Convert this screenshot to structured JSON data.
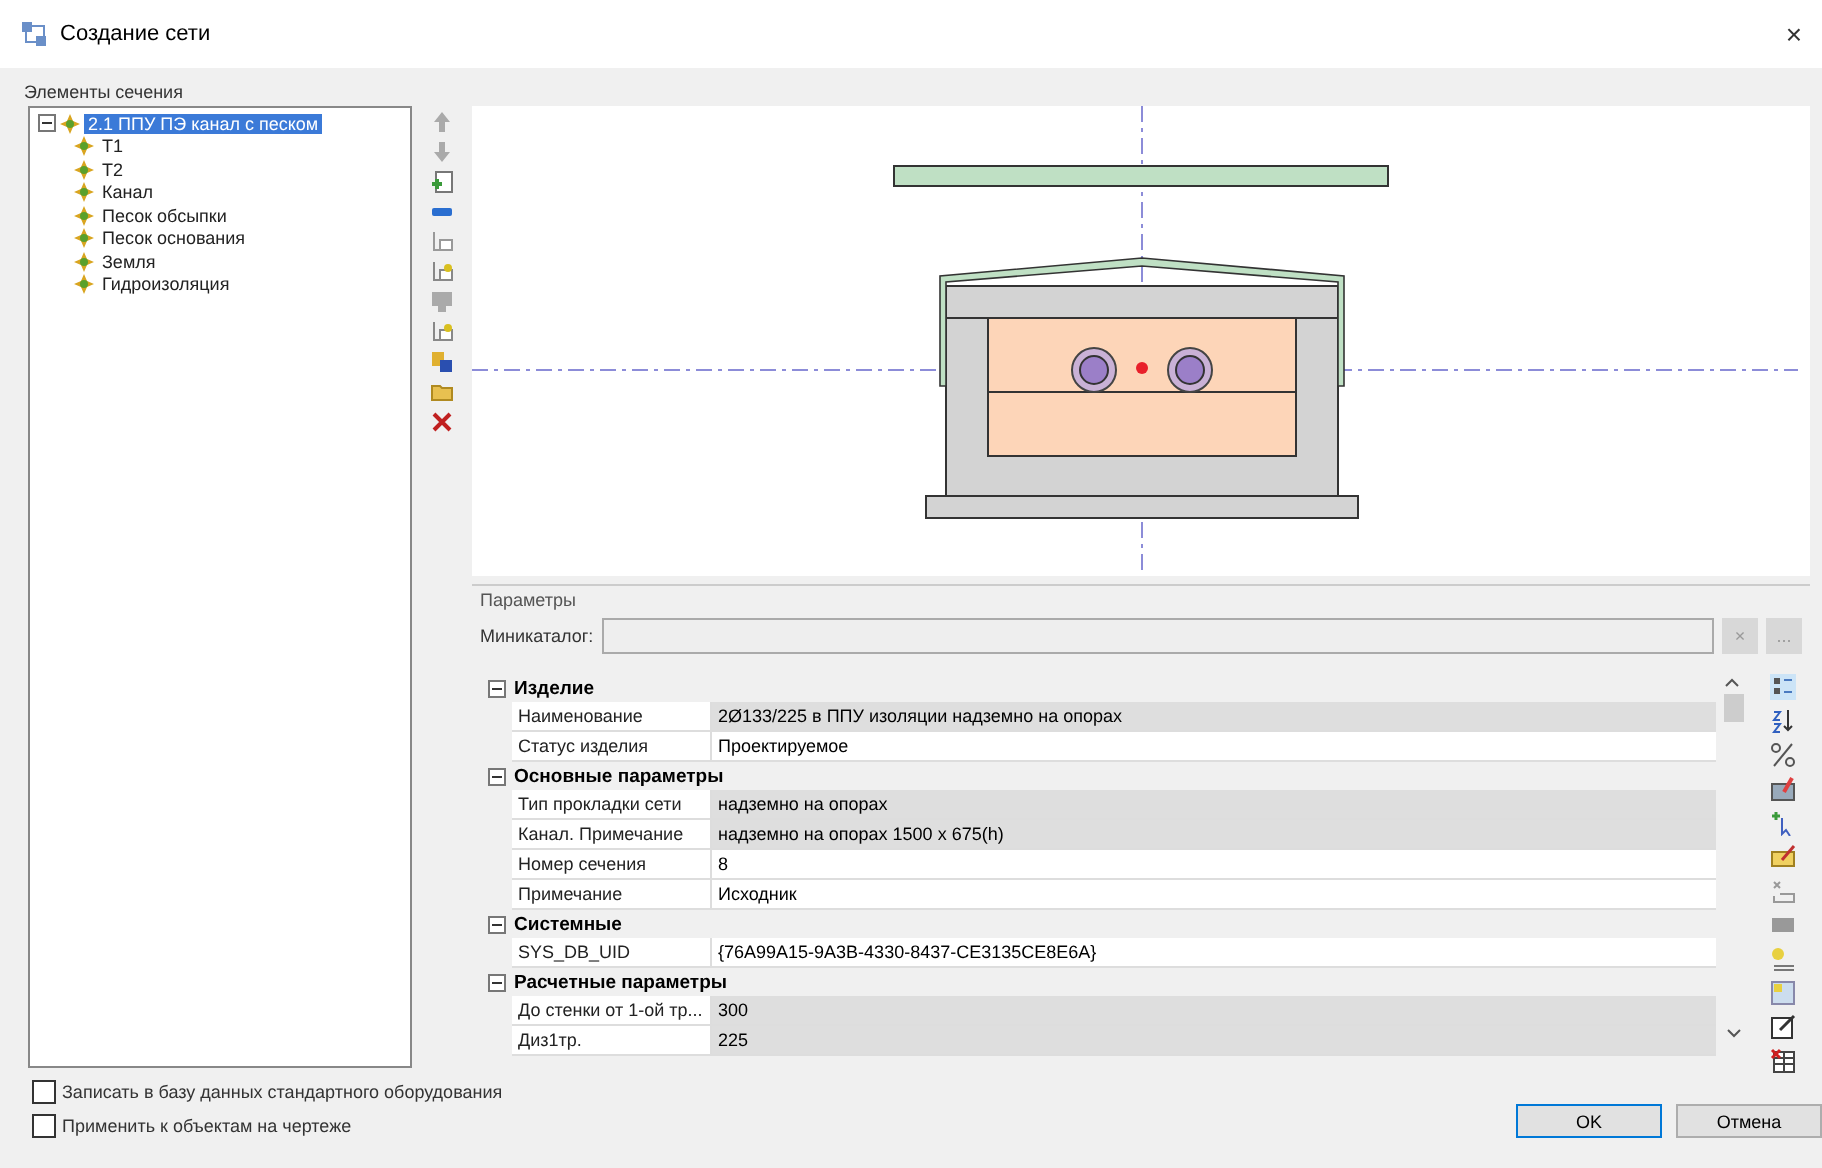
{
  "window": {
    "title": "Создание сети",
    "close": "×"
  },
  "tree_label": "Элементы сечения",
  "tree": [
    {
      "label": "2.1 ППУ ПЭ канал с песком",
      "selected": true,
      "expanded": true,
      "children": [
        {
          "label": "T1",
          "selected": false
        },
        {
          "label": "T2",
          "selected": false
        },
        {
          "label": "Канал",
          "selected": false
        },
        {
          "label": "Песок обсыпки",
          "selected": false
        },
        {
          "label": "Песок основания",
          "selected": false
        },
        {
          "label": "Земля",
          "selected": false
        },
        {
          "label": "Гидроизоляция",
          "selected": false
        }
      ]
    }
  ],
  "parameters": {
    "title": "Параметры",
    "minicatalog_label": "Миникаталог:",
    "clear_button": "×",
    "browse_button": "...",
    "categories": [
      {
        "title": "Изделие",
        "expanded": true,
        "rows": [
          {
            "name": "Наименование",
            "value": "2Ø133/225 в ППУ изоляции надземно на опорах",
            "readonly": true
          },
          {
            "name": "Статус изделия",
            "value": "Проектируемое",
            "readonly": false
          }
        ]
      },
      {
        "title": "Основные параметры",
        "expanded": true,
        "rows": [
          {
            "name": "Тип прокладки сети",
            "value": "надземно на опорах",
            "readonly": true
          },
          {
            "name": "Канал. Примечание",
            "value": "надземно на опорах 1500 x 675(h)",
            "readonly": true
          },
          {
            "name": "Номер сечения",
            "value": "8",
            "readonly": false
          },
          {
            "name": "Примечание",
            "value": "Исходник",
            "readonly": false
          }
        ]
      },
      {
        "title": "Системные",
        "expanded": true,
        "rows": [
          {
            "name": "SYS_DB_UID",
            "value": "{76A99A15-9A3B-4330-8437-CE3135CE8E6A}",
            "readonly": false
          }
        ]
      },
      {
        "title": "Расчетные параметры",
        "expanded": true,
        "rows": [
          {
            "name": "До стенки от 1-ой тр...",
            "value": "300",
            "readonly": true
          },
          {
            "name": "Диз1тр.",
            "value": "225",
            "readonly": true
          }
        ]
      }
    ]
  },
  "options": [
    {
      "label": "Записать в базу данных стандартного оборудования",
      "checked": false
    },
    {
      "label": "Применить к объектам на чертеже",
      "checked": false
    }
  ],
  "buttons": [
    {
      "label": "OK",
      "default": true
    },
    {
      "label": "Отмена",
      "default": false
    }
  ]
}
